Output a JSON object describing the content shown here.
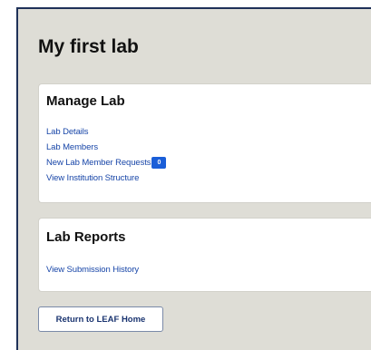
{
  "page": {
    "title": "My first lab"
  },
  "manage_lab": {
    "title": "Manage Lab",
    "links": [
      {
        "label": "Lab Details"
      },
      {
        "label": "Lab Members"
      },
      {
        "label": "New Lab Member Requests",
        "badge": "0"
      },
      {
        "label": "View Institution Structure"
      }
    ]
  },
  "lab_reports": {
    "title": "Lab Reports",
    "links": [
      {
        "label": "View Submission History"
      }
    ]
  },
  "footer": {
    "return_button_label": "Return to LEAF Home"
  },
  "colors": {
    "link": "#1846a8",
    "badge_background": "#1a5ed8",
    "page_background": "#deddd6",
    "frame_border": "#1f3158"
  }
}
